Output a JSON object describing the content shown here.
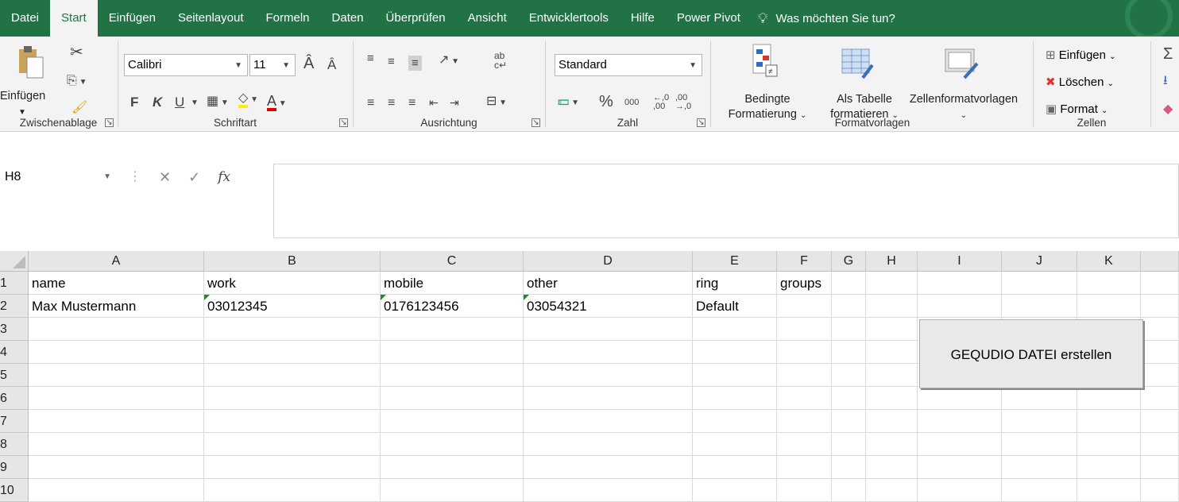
{
  "tabs": [
    "Datei",
    "Start",
    "Einfügen",
    "Seitenlayout",
    "Formeln",
    "Daten",
    "Überprüfen",
    "Ansicht",
    "Entwicklertools",
    "Hilfe",
    "Power Pivot"
  ],
  "tell_me": "Was möchten Sie tun?",
  "ribbon": {
    "clipboard": {
      "label": "Zwischenablage",
      "paste_label": "Einfügen"
    },
    "font": {
      "label": "Schriftart",
      "font_name": "Calibri",
      "font_size": "11",
      "bold": "F",
      "italic": "K",
      "underline": "U"
    },
    "alignment": {
      "label": "Ausrichtung"
    },
    "number": {
      "label": "Zahl",
      "format": "Standard",
      "percent": "%",
      "thousands": "000"
    },
    "styles": {
      "label": "Formatvorlagen",
      "conditional_line1": "Bedingte",
      "conditional_line2": "Formatierung",
      "table_line1": "Als Tabelle",
      "table_line2": "formatieren",
      "cellstyles": "Zellenformatvorlagen"
    },
    "cells": {
      "label": "Zellen",
      "insert": "Einfügen",
      "delete": "Löschen",
      "format": "Format"
    }
  },
  "formula_bar": {
    "name_box": "H8",
    "fx": "fx",
    "content": ""
  },
  "grid": {
    "columns": [
      {
        "name": "A",
        "width": 221
      },
      {
        "name": "B",
        "width": 222
      },
      {
        "name": "C",
        "width": 180
      },
      {
        "name": "D",
        "width": 213
      },
      {
        "name": "E",
        "width": 106
      },
      {
        "name": "F",
        "width": 69
      },
      {
        "name": "G",
        "width": 43
      },
      {
        "name": "H",
        "width": 65
      },
      {
        "name": "I",
        "width": 106
      },
      {
        "name": "J",
        "width": 95
      },
      {
        "name": "K",
        "width": 80
      }
    ],
    "rows": [
      "1",
      "2",
      "3",
      "4",
      "5",
      "6",
      "7",
      "8",
      "9",
      "10"
    ],
    "cells": [
      [
        "name",
        "work",
        "mobile",
        "other",
        "ring",
        "groups",
        "",
        "",
        "",
        "",
        ""
      ],
      [
        "Max Mustermann",
        "03012345",
        "0176123456",
        "03054321",
        "Default",
        "",
        "",
        "",
        "",
        "",
        ""
      ]
    ],
    "text_as_number_flags": [
      [
        1,
        1
      ],
      [
        1,
        2
      ],
      [
        1,
        3
      ]
    ]
  },
  "macro_button": "GEQUDIO DATEI erstellen",
  "colors": {
    "accent": "#217346",
    "header_bg": "#e6e6e6",
    "ribbon_bg": "#f3f3f3"
  }
}
